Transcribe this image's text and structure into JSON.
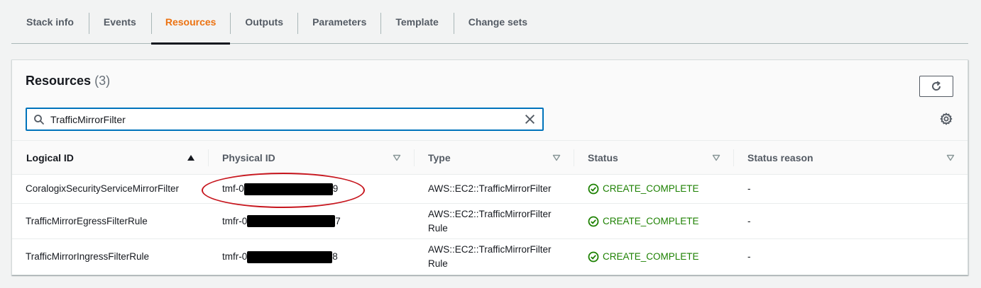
{
  "tabs": [
    {
      "label": "Stack info",
      "active": false
    },
    {
      "label": "Events",
      "active": false
    },
    {
      "label": "Resources",
      "active": true
    },
    {
      "label": "Outputs",
      "active": false
    },
    {
      "label": "Parameters",
      "active": false
    },
    {
      "label": "Template",
      "active": false
    },
    {
      "label": "Change sets",
      "active": false
    }
  ],
  "panel": {
    "title": "Resources",
    "count": "(3)"
  },
  "search": {
    "value": "TrafficMirrorFilter"
  },
  "columns": [
    {
      "label": "Logical ID",
      "sort": "ascending"
    },
    {
      "label": "Physical ID",
      "sort": "none"
    },
    {
      "label": "Type",
      "sort": "none"
    },
    {
      "label": "Status",
      "sort": "none"
    },
    {
      "label": "Status reason",
      "sort": "none"
    }
  ],
  "rows": [
    {
      "logical_id": "CoralogixSecurityServiceMirrorFilter",
      "physical_prefix": "tmf-0",
      "physical_suffix": "9",
      "type": "AWS::EC2::TrafficMirrorFilter",
      "status": "CREATE_COMPLETE",
      "reason": "-"
    },
    {
      "logical_id": "TrafficMirrorEgressFilterRule",
      "physical_prefix": "tmfr-0",
      "physical_suffix": "7",
      "type": "AWS::EC2::TrafficMirrorFilter Rule",
      "status": "CREATE_COMPLETE",
      "reason": "-"
    },
    {
      "logical_id": "TrafficMirrorIngressFilterRule",
      "physical_prefix": "tmfr-0",
      "physical_suffix": "8",
      "type": "AWS::EC2::TrafficMirrorFilter Rule",
      "status": "CREATE_COMPLETE",
      "reason": "-"
    }
  ],
  "colors": {
    "accent": "#ec7211",
    "focus": "#0073bb",
    "success": "#1d8102",
    "annotation": "#c7161e"
  },
  "icons": {
    "refresh": "refresh-icon",
    "search": "search-icon",
    "clear": "close-icon",
    "settings": "gear-icon",
    "sort_ascending": "caret-up-icon",
    "sortable": "caret-down-outline-icon",
    "status_ok": "check-circle-icon"
  }
}
